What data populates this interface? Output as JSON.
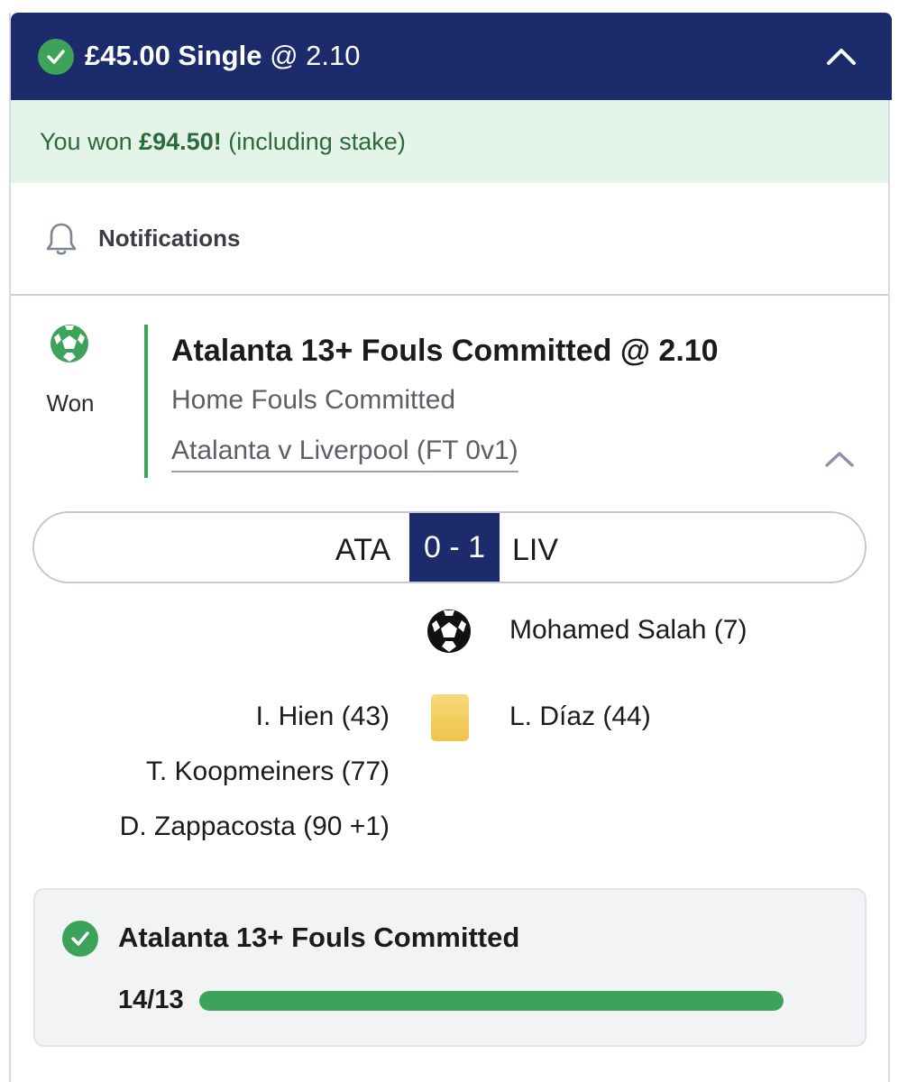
{
  "header": {
    "stake_type": "£45.00 Single",
    "odds": "@ 2.10",
    "status_icon": "check-circle-icon",
    "collapse_icon": "chevron-up-icon"
  },
  "result_banner": {
    "prefix": "You won",
    "amount": "£94.50!",
    "suffix": "(including stake)"
  },
  "notifications": {
    "label": "Notifications",
    "icon": "bell-icon"
  },
  "selection": {
    "sport_icon": "football-icon",
    "status": "Won",
    "title": "Atalanta 13+ Fouls Committed @ 2.10",
    "market": "Home Fouls Committed",
    "event": "Atalanta v Liverpool (FT 0v1)"
  },
  "scoreboard": {
    "home": "ATA",
    "score": "0 - 1",
    "away": "LIV"
  },
  "events": [
    {
      "type": "goal",
      "icon": "football-icon",
      "home": "",
      "away": "Mohamed Salah (7)"
    },
    {
      "type": "yellow-card",
      "icon": "yellow-card-icon",
      "home": "I. Hien (43)",
      "away": "L. Díaz (44)"
    },
    {
      "type": "yellow-card",
      "icon": "",
      "home": "T. Koopmeiners (77)",
      "away": ""
    },
    {
      "type": "yellow-card",
      "icon": "",
      "home": "D. Zappacosta (90 +1)",
      "away": ""
    }
  ],
  "progress": {
    "title": "Atalanta 13+ Fouls Committed",
    "count_text": "14/13",
    "fraction": 1.0
  },
  "colors": {
    "navy": "#1b2b6b",
    "green": "#3da25a",
    "banner_bg": "#e4f4e8",
    "yellow_card": "#f0c24a"
  }
}
